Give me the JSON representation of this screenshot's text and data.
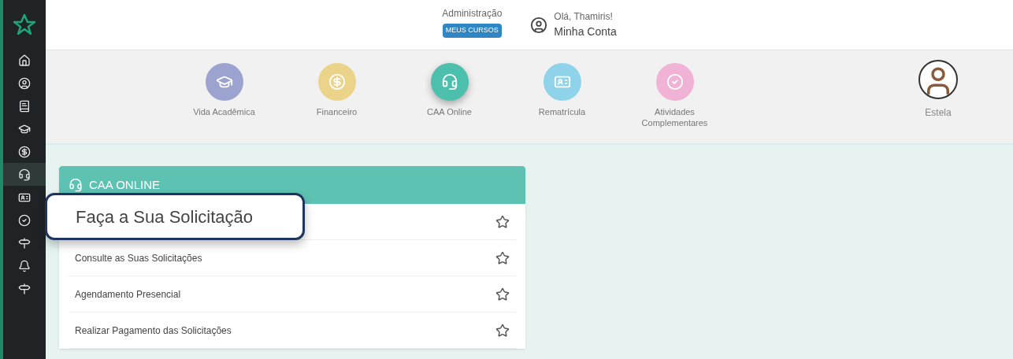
{
  "sidebar": {
    "items": [
      {
        "kind": "home",
        "selected": false
      },
      {
        "kind": "user",
        "selected": false
      },
      {
        "kind": "book",
        "selected": false
      },
      {
        "kind": "academic",
        "selected": false
      },
      {
        "kind": "finance",
        "selected": false
      },
      {
        "kind": "support",
        "selected": true
      },
      {
        "kind": "card",
        "selected": false
      },
      {
        "kind": "check",
        "selected": false
      },
      {
        "kind": "signpost",
        "selected": false
      },
      {
        "kind": "bell",
        "selected": false
      },
      {
        "kind": "signpost",
        "selected": false
      }
    ]
  },
  "header": {
    "admin_label": "Administração",
    "courses_button": "MEUS CURSOS",
    "greeting": "Olá, Thamiris!",
    "account_link": "Minha Conta"
  },
  "nav": [
    {
      "kind": "academic",
      "label": "Vida Acadêmica",
      "color": "#9da3cf",
      "selected": false
    },
    {
      "kind": "finance",
      "label": "Financeiro",
      "color": "#ecd38a",
      "selected": false
    },
    {
      "kind": "support",
      "label": "CAA Online",
      "color": "#4dbfad",
      "selected": true
    },
    {
      "kind": "card",
      "label": "Rematrícula",
      "color": "#8fd3ea",
      "selected": false
    },
    {
      "kind": "check",
      "label": "Atividades Complementares",
      "color": "#f0b3d6",
      "selected": false
    }
  ],
  "profile": {
    "name": "Estela"
  },
  "card": {
    "title": "CAA ONLINE",
    "callout": "Faça a Sua Solicitação",
    "rows": [
      {
        "label": "Consulte as Suas Solicitações",
        "favorite": false
      },
      {
        "label": "Agendamento Presencial",
        "favorite": false
      },
      {
        "label": "Realizar Pagamento das Solicitações",
        "favorite": false
      }
    ]
  }
}
